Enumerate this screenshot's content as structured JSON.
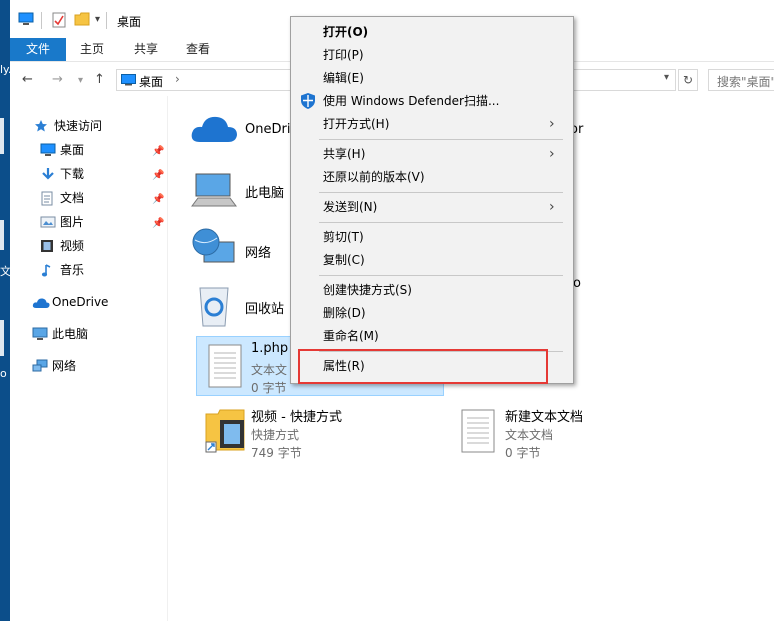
{
  "window": {
    "title": "桌面"
  },
  "ribbon": {
    "tabs": [
      "文件",
      "主页",
      "共享",
      "查看"
    ]
  },
  "address": {
    "location": "桌面",
    "search_placeholder": "搜索\"桌面\""
  },
  "desktop_fragments": [
    "ly.",
    "文",
    "o"
  ],
  "navigation": {
    "quick_access": "快速访问",
    "items": [
      {
        "label": "桌面",
        "icon": "desktop-icon",
        "pinned": true
      },
      {
        "label": "下载",
        "icon": "download-icon",
        "pinned": true
      },
      {
        "label": "文档",
        "icon": "documents-icon",
        "pinned": true
      },
      {
        "label": "图片",
        "icon": "pictures-icon",
        "pinned": true
      },
      {
        "label": "视频",
        "icon": "videos-icon",
        "pinned": false
      },
      {
        "label": "音乐",
        "icon": "music-icon",
        "pinned": false
      }
    ],
    "onedrive": "OneDrive",
    "this_pc": "此电脑",
    "network": "网络"
  },
  "files": [
    {
      "name": "OneDri",
      "icon": "onedrive-cloud-icon"
    },
    {
      "name": "此电脑",
      "icon": "computer-icon"
    },
    {
      "name": "网络",
      "icon": "network-globe-icon"
    },
    {
      "name": "回收站",
      "icon": "recycle-bin-icon"
    },
    {
      "name": "1.php",
      "type": "文本文",
      "size": "0 字节",
      "icon": "text-file-icon",
      "selected": true
    },
    {
      "name": "视频 - 快捷方式",
      "type": "快捷方式",
      "size": "749 字节",
      "icon": "video-shortcut-icon"
    },
    {
      "name": "新建文本文档",
      "type": "文本文档",
      "size": "0 字节",
      "icon": "text-file-icon"
    },
    {
      "fragment": "or"
    },
    {
      "fragment": "ro"
    }
  ],
  "context_menu": {
    "items": [
      {
        "label": "打开(O)",
        "bold": true
      },
      {
        "label": "打印(P)"
      },
      {
        "label": "编辑(E)"
      },
      {
        "label": "使用 Windows Defender扫描...",
        "icon": "defender-shield-icon"
      },
      {
        "label": "打开方式(H)",
        "submenu": true
      },
      {
        "label": "共享(H)",
        "submenu": true
      },
      {
        "label": "还原以前的版本(V)"
      },
      {
        "label": "发送到(N)",
        "submenu": true
      },
      {
        "label": "剪切(T)"
      },
      {
        "label": "复制(C)"
      },
      {
        "label": "创建快捷方式(S)"
      },
      {
        "label": "删除(D)"
      },
      {
        "label": "重命名(M)"
      },
      {
        "label": "属性(R)",
        "highlighted": true
      }
    ]
  },
  "colors": {
    "accent": "#1979ca",
    "selection": "#cce8ff",
    "highlight_box": "#e53935"
  }
}
